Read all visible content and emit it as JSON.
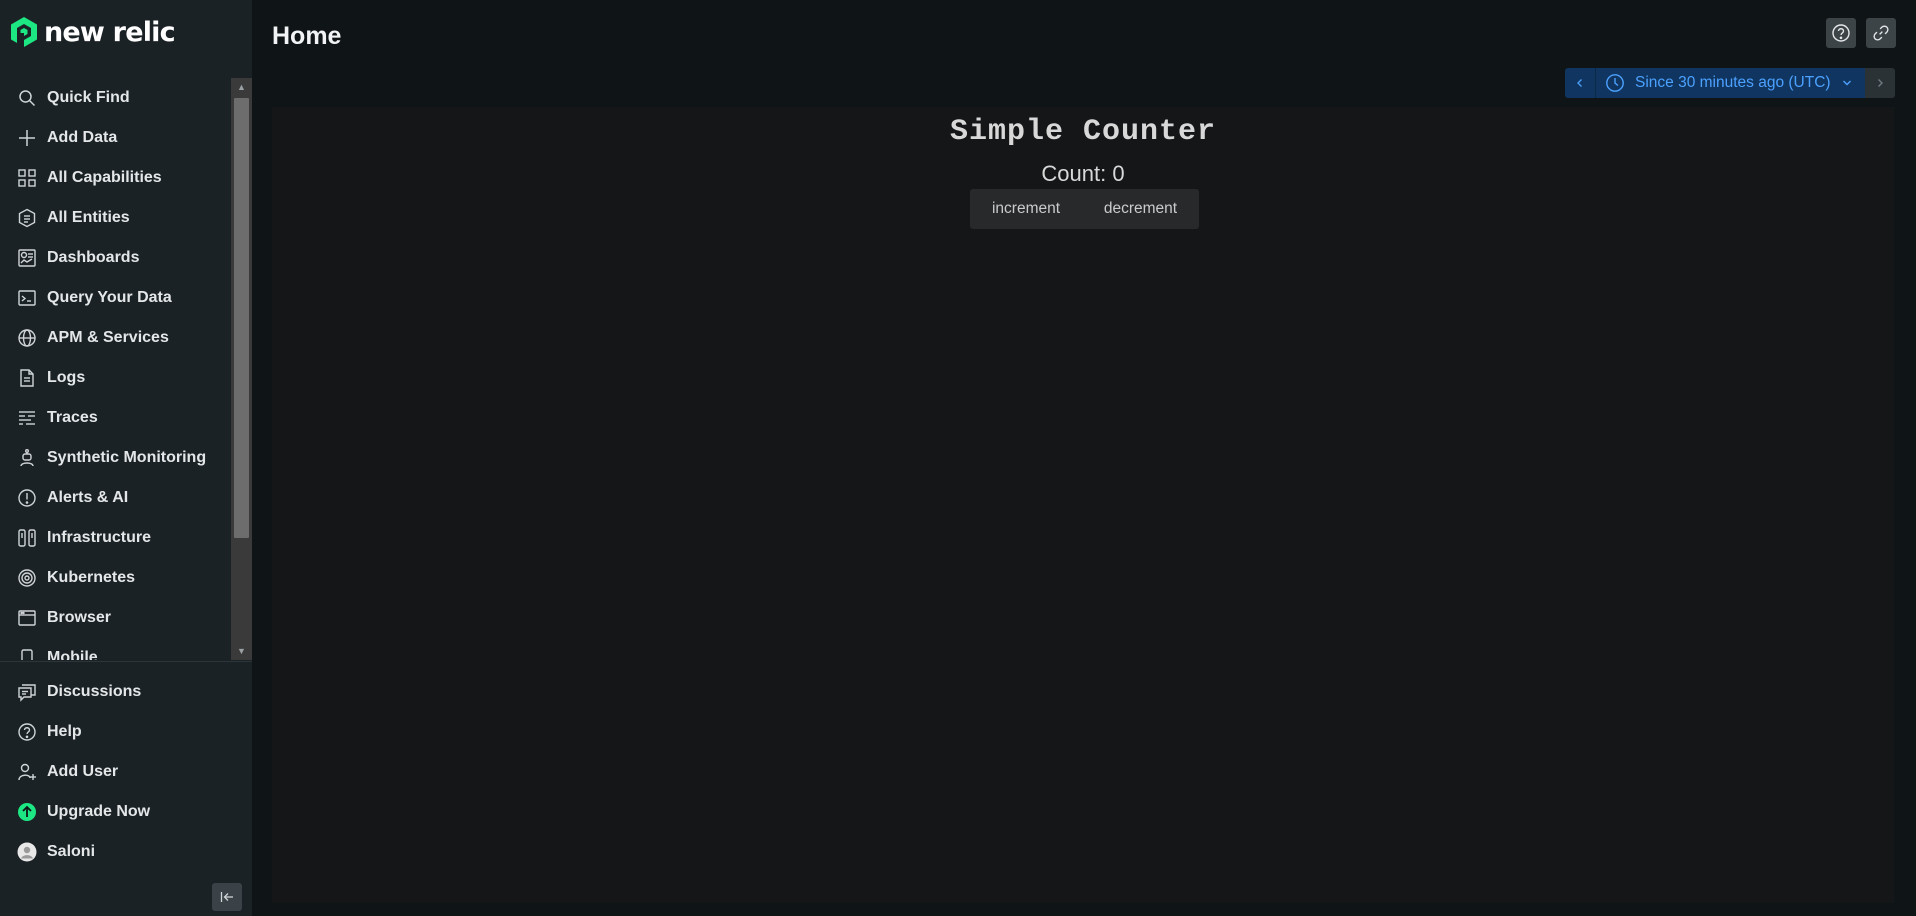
{
  "brand": {
    "name": "new relic",
    "accent": "#1ce783"
  },
  "sidebar": {
    "items": [
      {
        "label": "Quick Find",
        "icon": "search-icon"
      },
      {
        "label": "Add Data",
        "icon": "plus-icon"
      },
      {
        "label": "All Capabilities",
        "icon": "grid-icon"
      },
      {
        "label": "All Entities",
        "icon": "hexagon-list-icon"
      },
      {
        "label": "Dashboards",
        "icon": "dashboard-icon"
      },
      {
        "label": "Query Your Data",
        "icon": "terminal-icon"
      },
      {
        "label": "APM & Services",
        "icon": "globe-icon"
      },
      {
        "label": "Logs",
        "icon": "document-icon"
      },
      {
        "label": "Traces",
        "icon": "traces-icon"
      },
      {
        "label": "Synthetic Monitoring",
        "icon": "robot-icon"
      },
      {
        "label": "Alerts & AI",
        "icon": "alert-icon"
      },
      {
        "label": "Infrastructure",
        "icon": "infrastructure-icon"
      },
      {
        "label": "Kubernetes",
        "icon": "kubernetes-icon"
      },
      {
        "label": "Browser",
        "icon": "browser-icon"
      },
      {
        "label": "Mobile",
        "icon": "mobile-icon"
      }
    ],
    "bottom_items": [
      {
        "label": "Discussions",
        "icon": "discussions-icon"
      },
      {
        "label": "Help",
        "icon": "help-icon"
      },
      {
        "label": "Add User",
        "icon": "add-user-icon"
      },
      {
        "label": "Upgrade Now",
        "icon": "upgrade-icon"
      },
      {
        "label": "Saloni",
        "icon": "avatar-icon"
      }
    ]
  },
  "header": {
    "title": "Home",
    "time_picker": {
      "label": "Since 30 minutes ago (UTC)"
    }
  },
  "counter": {
    "title": "Simple Counter",
    "count_text": "Count: 0",
    "increment_label": "increment",
    "decrement_label": "decrement"
  }
}
